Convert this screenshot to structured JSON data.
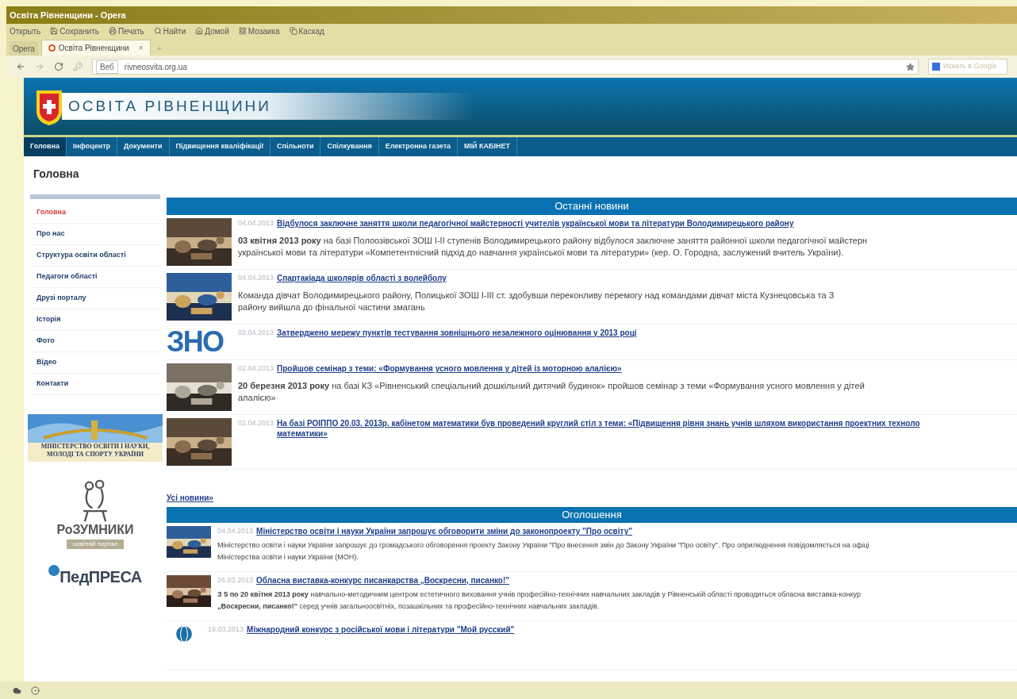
{
  "window": {
    "title": "Освіта Рівненщини - Opera"
  },
  "toolbar": [
    "Открыть",
    "Сохранить",
    "Печать",
    "Найти",
    "Домой",
    "Мозаика",
    "Каскад"
  ],
  "tabs": {
    "menu_button": "Opera",
    "items": [
      {
        "label": "Освіта Рівненщини",
        "selected": true,
        "close": "×"
      }
    ],
    "new_tab": "+"
  },
  "address_bar": {
    "badge": "Веб",
    "url": "rivneosvita.org.ua",
    "search_placeholder": "Искать в Google"
  },
  "site": {
    "title": "ОСВІТА РІВНЕНЩИНИ",
    "nav": [
      {
        "label": "Головна",
        "selected": true
      },
      {
        "label": "Інфоцентр",
        "selected": false
      },
      {
        "label": "Документи",
        "selected": false
      },
      {
        "label": "Підвищення кваліфікації",
        "selected": false
      },
      {
        "label": "Спільноти",
        "selected": false
      },
      {
        "label": "Спілкування",
        "selected": false
      },
      {
        "label": "Електронна газета",
        "selected": false
      },
      {
        "label": "МІЙ КАБІНЕТ",
        "selected": false
      }
    ],
    "page_title": "Головна"
  },
  "sidebar": {
    "items": [
      {
        "label": "Головна",
        "selected": true
      },
      {
        "label": "Про нас",
        "selected": false
      },
      {
        "label": "Структура освіти області",
        "selected": false
      },
      {
        "label": "Педагоги області",
        "selected": false
      },
      {
        "label": "Друзі порталу",
        "selected": false
      },
      {
        "label": "Історія",
        "selected": false
      },
      {
        "label": "Фото",
        "selected": false
      },
      {
        "label": "Відео",
        "selected": false
      },
      {
        "label": "Контакти",
        "selected": false
      }
    ],
    "banners": [
      {
        "kind": "ministry",
        "caption": "МІНІСТЕРСТВО ОСВІТИ І НАУКИ, МОЛОДІ ТА СПОРТУ УКРАЇНИ"
      },
      {
        "kind": "rozumnyky",
        "name": "РоЗУМНИКИ",
        "tagline": "освітній портал"
      },
      {
        "kind": "pedpresa",
        "name": "ПедПРЕСА"
      }
    ]
  },
  "news": {
    "heading": "Останні новини",
    "items": [
      {
        "date": "04.04.2013",
        "title_lines": [
          "Відбулося заключне заняття школи педагогічної майстерності учителів української мови та літератури Володимирецького району"
        ],
        "body_lines": [
          "**03 квітня 2013 року** на базі Полоозівської ЗОШ I-II ступенів Володимирецького району відбулося заключне заняття районної школи педагогічної майстерн",
          "української мови та літератури «Компетентнісний підхід до навчання української мови та літератури» (кер. О. Городна, заслужений вчитель України)."
        ]
      },
      {
        "date": "04.04.2013",
        "title_lines": [
          "Спартакіада школярів області з волейболу"
        ],
        "body_lines": [
          "Команда дівчат Володимирецького району, Полицької ЗОШ І-ІІІ ст. здобувши переконливу перемогу над командами дівчат міста Кузнецовська та З",
          "району вийшла до фінальної частини змагань"
        ]
      },
      {
        "kind": "logo",
        "logo_text": "ЗНО",
        "date": "02.04.2013",
        "title_lines": [
          "Затверджено мережу пунктів тестування зовнішнього незалежного оцінювання у 2013 році"
        ]
      },
      {
        "date": "02.04.2013",
        "title_lines": [
          "Пройшов семінар з теми: «Формування усного мовлення у дітей із моторною алалією»"
        ],
        "body_lines": [
          "**20 березня 2013 року** на базі КЗ «Рівненський спеціальний дошкільний дитячий будинок» пройшов семінар з теми «Формування усного мовлення у дітей",
          "алалією»"
        ]
      },
      {
        "date": "02.04.2013",
        "title_lines": [
          "На базі РОІППО 20.03. 2013р. кабінетом математики був проведений круглий стіл з теми: «Підвищення рівня знань учнів шляхом використання проектних техноло",
          "математики»"
        ]
      }
    ],
    "all_link": "Усі новини»"
  },
  "announcements": {
    "heading": "Оголошення",
    "items": [
      {
        "date": "04.04.2013",
        "title_lines": [
          "Міністерство освіти і науки України запрошує обговорити зміни до законопроекту \"Про освіту\""
        ],
        "body_lines": [
          "Міністерство освіти і науки України запрошує до громадського обговорення проекту Закону України \"Про внесення змін до Закону України \"Про освіту\". Про оприлюднення повідомляється на офіці",
          "Міністерства освіти і науки України (МОН)."
        ]
      },
      {
        "date": "26.03.2013",
        "title_lines": [
          "Обласна виставка-конкурс писанкарства „Воскресни, писанко!\""
        ],
        "body_lines": [
          "**З 5 по 20 квітня 2013 року** навчально-методичним центром естетичного виховання учнів професійно-технічних навчальних закладів у Рівненській області проводиться обласна виставка-конкур",
          "**„Воскресни, писанко!\"** серед учнів загальноосвітніх, позашкільних та професійно-технічних навчальних закладів."
        ]
      },
      {
        "kind": "globe",
        "date": "19.03.2013",
        "title_lines": [
          "Міжнародний конкурс з російської мови і літератури \"Мой русский\""
        ]
      }
    ]
  }
}
